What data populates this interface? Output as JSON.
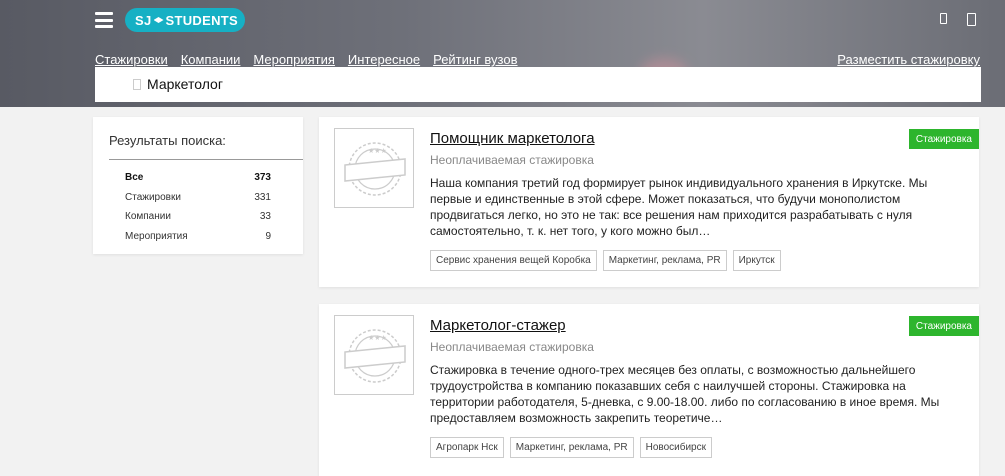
{
  "header": {
    "logo_text": "SJ",
    "logo_text2": "STUDENTS",
    "brand_color": "#16b0c4",
    "menu_icon": "hamburger-icon",
    "icons": [
      "phone-icon",
      "tablet-icon"
    ]
  },
  "nav": {
    "items": [
      "Стажировки",
      "Компании",
      "Мероприятия",
      "Интересное",
      "Рейтинг вузов"
    ],
    "post_internship": "Разместить стажировку"
  },
  "search": {
    "value": "Маркетолог",
    "icon": "search-icon"
  },
  "sidebar": {
    "title": "Результаты поиска:",
    "items": [
      {
        "label": "Все",
        "count": "373"
      },
      {
        "label": "Стажировки",
        "count": "331"
      },
      {
        "label": "Компании",
        "count": "33"
      },
      {
        "label": "Мероприятия",
        "count": "9"
      }
    ]
  },
  "results": [
    {
      "title": "Помощник маркетолога",
      "subtitle": "Неоплачиваемая стажировка",
      "badge": "Стажировка",
      "badge_color": "#2db52d",
      "description": "Наша компания третий год формирует рынок индивидуального хранения в Иркутске. Мы первые и единственные в этой сфере. Может показаться, что будучи монополистом продвигаться легко, но это не так: все решения нам приходится разрабатывать с нуля самостоятельно, т. к. нет того, у кого можно был…",
      "tags": [
        "Сервис хранения вещей Коробка",
        "Маркетинг, реклама, PR",
        "Иркутск"
      ]
    },
    {
      "title": "Маркетолог-стажер",
      "subtitle": "Неоплачиваемая стажировка",
      "badge": "Стажировка",
      "badge_color": "#2db52d",
      "description": "Стажировка в течение одного-трех месяцев без оплаты, с возможностью дальнейшего трудоустройства в компанию показавших себя с наилучшей стороны. Стажировка на территории работодателя, 5-дневка, с 9.00-18.00. либо по согласованию в иное время. Мы предоставляем возможность закрепить теоретиче…",
      "tags": [
        "Агропарк Нск",
        "Маркетинг, реклама, PR",
        "Новосибирск"
      ]
    }
  ]
}
